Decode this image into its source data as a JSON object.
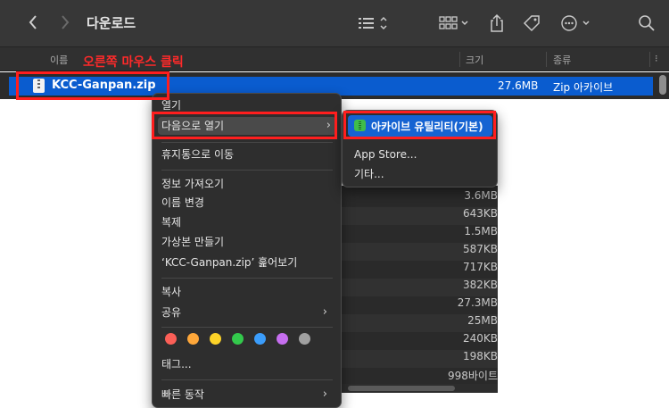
{
  "toolbar": {
    "title": "다운로드"
  },
  "list": {
    "columns": {
      "name": "이름",
      "size": "크기",
      "kind": "종류"
    },
    "annotation": "오른쪽 마우스 클릭",
    "selected_file": {
      "name": "KCC-Ganpan.zip",
      "size": "27.6MB",
      "kind": "Zip 아카이브"
    },
    "background_sizes": [
      "3.6MB",
      "643KB",
      "1.5MB",
      "587KB",
      "717KB",
      "382KB",
      "27.3MB",
      "25MB",
      "240KB",
      "198KB",
      "998바이트"
    ]
  },
  "context_menu": {
    "items": {
      "open": "열기",
      "open_with": "다음으로 열기",
      "move_to_trash": "휴지통으로 이동",
      "get_info": "정보 가져오기",
      "rename": "이름 변경",
      "duplicate": "복제",
      "make_alias": "가상본 만들기",
      "quick_look": "‘KCC-Ganpan.zip’ 훑어보기",
      "copy": "복사",
      "share": "공유",
      "tags": "태그...",
      "quick_actions": "빠른 동작"
    },
    "tag_colors": [
      "#fb5f57",
      "#fea73a",
      "#fdd328",
      "#33c94c",
      "#3b9dfb",
      "#c66eef",
      "#a0a0a0"
    ]
  },
  "submenu": {
    "default_app": "아카이브 유틸리티(기본)",
    "app_store": "App Store...",
    "other": "기타..."
  },
  "colors": {
    "selection": "#0a5ccf",
    "annotation_red": "#ff1e1e"
  }
}
